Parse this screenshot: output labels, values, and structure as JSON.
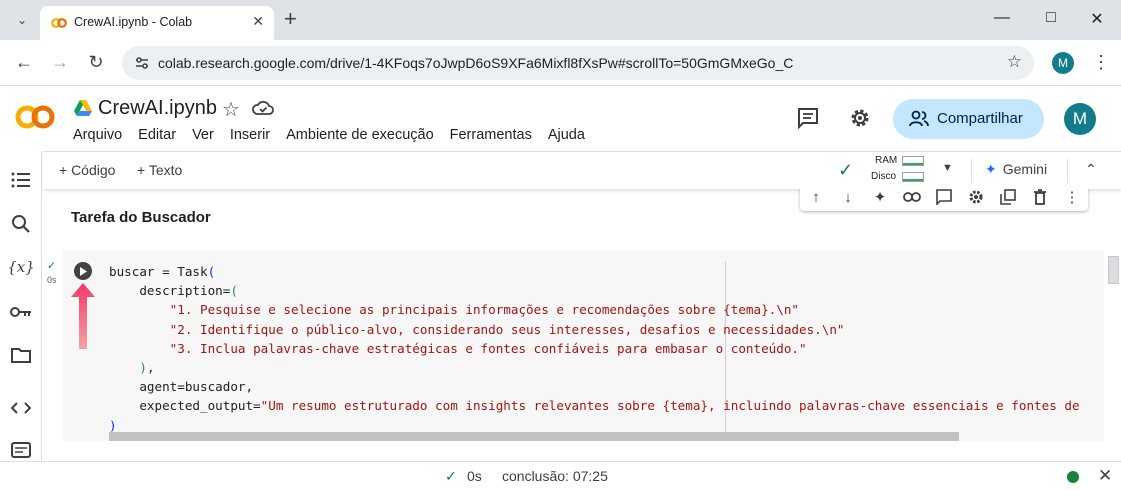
{
  "browser": {
    "tab_title": "CrewAI.ipynb - Colab",
    "url": "colab.research.google.com/drive/1-4KFoqs7oJwpD6oS9XFa6Mixfl8fXsPw#scrollTo=50GmGMxeGo_C",
    "profile_initial": "M"
  },
  "colab": {
    "notebook_title": "CrewAI.ipynb",
    "menu": [
      "Arquivo",
      "Editar",
      "Ver",
      "Inserir",
      "Ambiente de execução",
      "Ferramentas",
      "Ajuda"
    ],
    "share_label": "Compartilhar",
    "profile_initial": "M",
    "accent_color": "#c2e7ff"
  },
  "toolbar": {
    "add_code": "+ Código",
    "add_text": "+ Texto",
    "ram_label": "RAM",
    "disk_label": "Disco",
    "gemini_label": "Gemini"
  },
  "notebook": {
    "heading": "Tarefa do Buscador",
    "cell_exec_time": "0s",
    "code_lines": [
      {
        "parts": [
          [
            "",
            "buscar = Task"
          ],
          [
            "br",
            "("
          ]
        ]
      },
      {
        "parts": [
          [
            "",
            "    description="
          ],
          [
            "br2",
            "("
          ]
        ]
      },
      {
        "parts": [
          [
            "",
            "        "
          ],
          [
            "str",
            "\"1. Pesquise e selecione as principais informações e recomendações sobre {tema}.\\n\""
          ]
        ]
      },
      {
        "parts": [
          [
            "",
            "        "
          ],
          [
            "str",
            "\"2. Identifique o público-alvo, considerando seus interesses, desafios e necessidades.\\n\""
          ]
        ]
      },
      {
        "parts": [
          [
            "",
            "        "
          ],
          [
            "str",
            "\"3. Inclua palavras-chave estratégicas e fontes confiáveis para embasar o conteúdo.\""
          ]
        ]
      },
      {
        "parts": [
          [
            "",
            "    "
          ],
          [
            "br2",
            ")"
          ],
          [
            "",
            ","
          ]
        ]
      },
      {
        "parts": [
          [
            "",
            "    agent=buscador,"
          ]
        ]
      },
      {
        "parts": [
          [
            "",
            "    expected_output="
          ],
          [
            "str",
            "\"Um resumo estruturado com insights relevantes sobre {tema}, incluindo palavras-chave essenciais e fontes de"
          ]
        ]
      },
      {
        "parts": [
          [
            "br",
            ")"
          ]
        ]
      }
    ]
  },
  "status": {
    "time": "0s",
    "completion": "conclusão: 07:25",
    "connected_color": "#188038"
  }
}
